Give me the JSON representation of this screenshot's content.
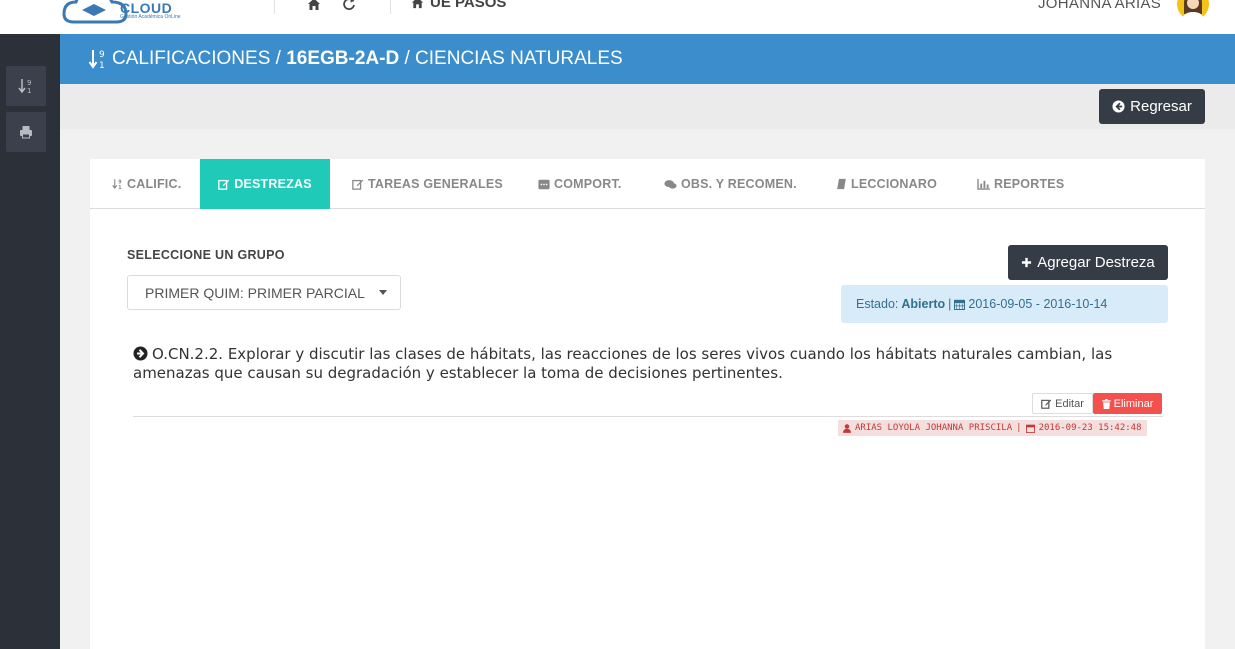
{
  "topbar": {
    "logo_text": "CLOUD",
    "logo_sub": "Gestión Académica OnLine",
    "school_name": "UE PASOS",
    "user_name": "JOHANNA ARIAS"
  },
  "header": {
    "section": "CALIFICACIONES",
    "separator": "/",
    "course": "16EGB-2A-D",
    "subject": "CIENCIAS NATURALES"
  },
  "actions": {
    "back_label": "Regresar"
  },
  "tabs": [
    {
      "label": "CALIFIC.",
      "icon": "sort-numeric-icon"
    },
    {
      "label": "DESTREZAS",
      "icon": "edit-icon",
      "active": true
    },
    {
      "label": "TAREAS GENERALES",
      "icon": "edit-icon"
    },
    {
      "label": "COMPORT.",
      "icon": "comment-box-icon"
    },
    {
      "label": "OBS. Y RECOMEN.",
      "icon": "comments-icon"
    },
    {
      "label": "LECCIONARO",
      "icon": "book-icon"
    },
    {
      "label": "REPORTES",
      "icon": "bar-chart-icon"
    }
  ],
  "group": {
    "label": "SELECCIONE UN GRUPO",
    "selected": "PRIMER QUIM: PRIMER PARCIAL"
  },
  "add_skill_label": "Agregar Destreza",
  "status": {
    "label": "Estado:",
    "value": "Abierto",
    "separator": "|",
    "range": "2016-09-05 - 2016-10-14"
  },
  "skill": {
    "text": "O.CN.2.2. Explorar y discutir las clases de hábitats, las reacciones de los seres vivos cuando los hábitats naturales cambian, las amenazas que causan su degradación y establecer la toma de decisiones pertinentes.",
    "edit_label": "Editar",
    "delete_label": "Eliminar",
    "author": "ARIAS LOYOLA JOHANNA PRISCILA",
    "separator": "|",
    "timestamp": "2016-09-23 15:42:48"
  },
  "colors": {
    "header": "#3b8dcb",
    "active_tab": "#1fcbb8",
    "dark_button": "#353c46",
    "delete": "#f2514e",
    "sidebar": "#2b3039",
    "status_bg": "#d8ebf8"
  }
}
